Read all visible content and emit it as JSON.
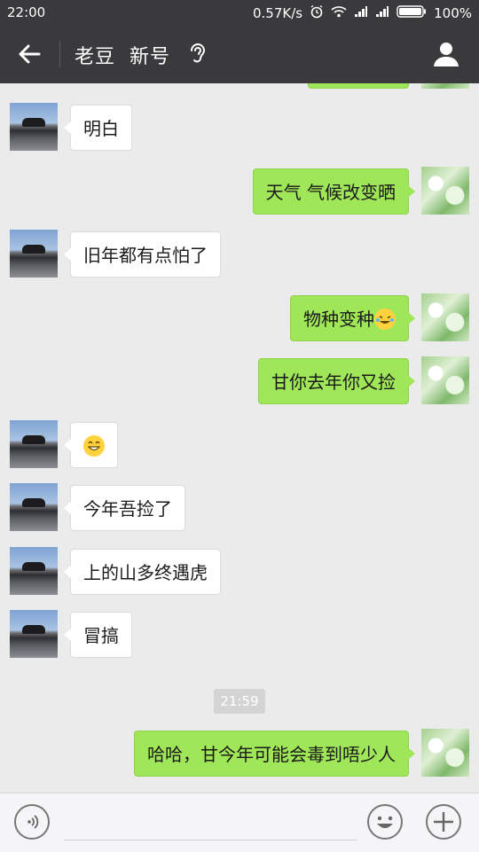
{
  "status_bar": {
    "time": "22:00",
    "network_speed": "0.57K/s",
    "battery": "100%",
    "icons": [
      "alarm-icon",
      "wifi-icon",
      "signal-icon",
      "signal-icon",
      "battery-icon"
    ]
  },
  "header": {
    "title": "老豆  新号",
    "icons": [
      "back-arrow-icon",
      "ear-icon",
      "profile-icon"
    ]
  },
  "messages": [
    {
      "side": "left",
      "text": "明白"
    },
    {
      "side": "right",
      "text": "天气 气候改变晒"
    },
    {
      "side": "left",
      "text": "旧年都有点怕了"
    },
    {
      "side": "right",
      "text": "物种变种",
      "emoji": "laughing-crying-emoji"
    },
    {
      "side": "right",
      "text": "甘你去年你又捡"
    },
    {
      "side": "left",
      "text": "",
      "emoji": "grinning-emoji"
    },
    {
      "side": "left",
      "text": "今年吾捡了"
    },
    {
      "side": "left",
      "text": "上的山多终遇虎"
    },
    {
      "side": "left",
      "text": "冒搞"
    },
    {
      "side": "right",
      "text": "哈哈，甘今年可能会毒到唔少人"
    }
  ],
  "timestamp": "21:59",
  "input_bar": {
    "icons": [
      "voice-icon",
      "emoji-icon",
      "plus-icon"
    ]
  }
}
